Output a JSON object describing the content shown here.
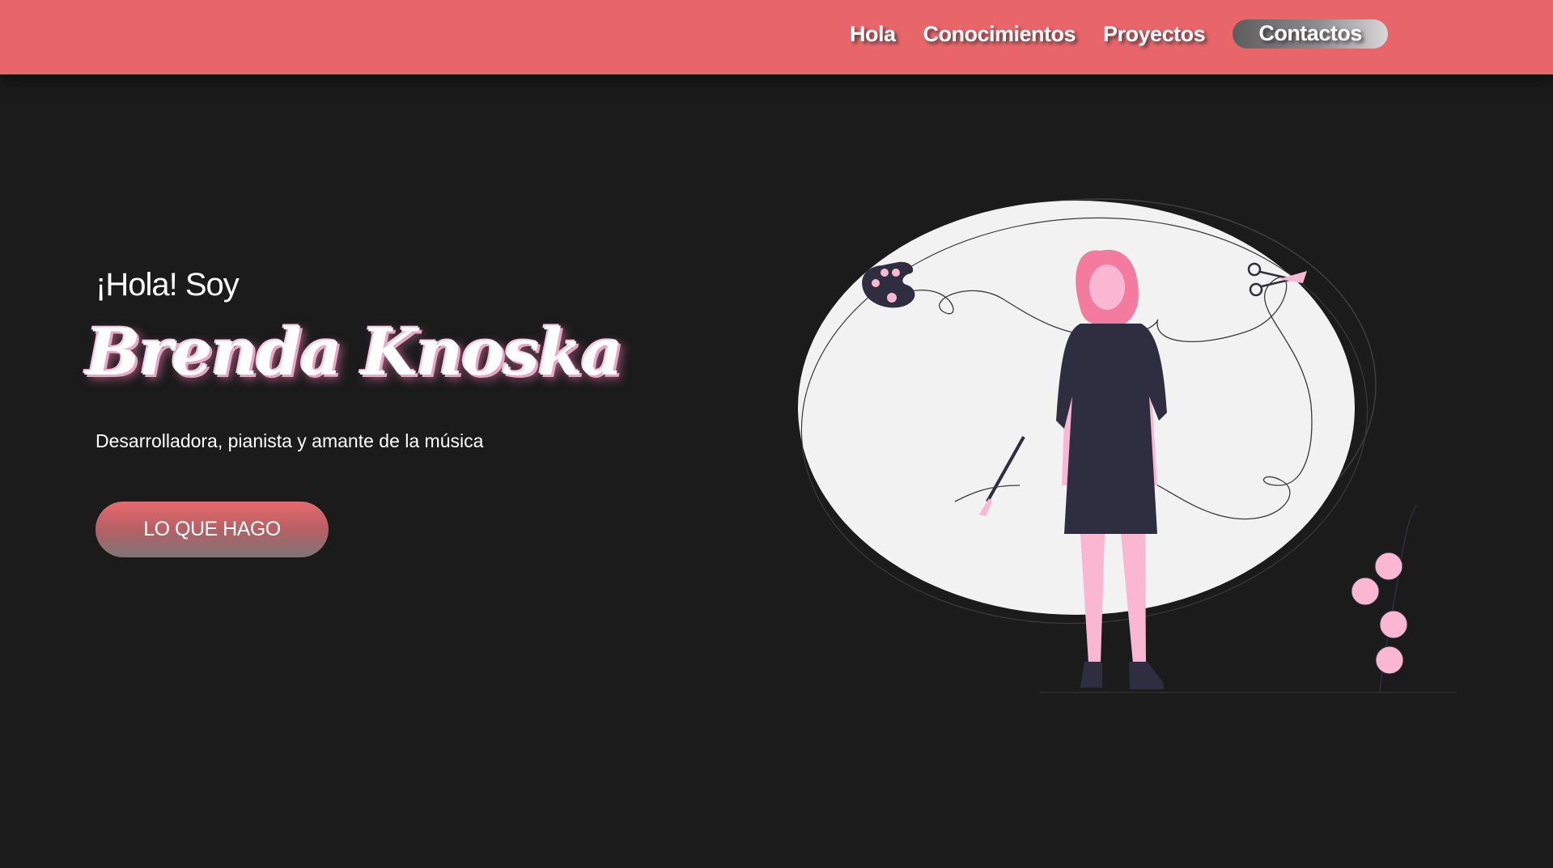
{
  "nav": {
    "items": [
      "Hola",
      "Conocimientos",
      "Proyectos"
    ],
    "contact": "Contactos"
  },
  "hero": {
    "greeting": "¡Hola! Soy",
    "name": "Brenda Knoska",
    "subtitle": "Desarrolladora, pianista y amante de la música",
    "cta": "LO QUE HAGO"
  },
  "colors": {
    "navbar": "#e8666a",
    "background": "#1b1b1b",
    "accent_pink": "#f37ba0",
    "light_pink": "#f9b7d1",
    "dress": "#2f2e41"
  },
  "icons": {
    "illustration": "woman-with-palette-and-scissors-illustration",
    "palette": "paint-palette-icon",
    "scissors": "scissors-icon",
    "brush": "paintbrush-icon",
    "plant": "flower-plant-icon"
  }
}
